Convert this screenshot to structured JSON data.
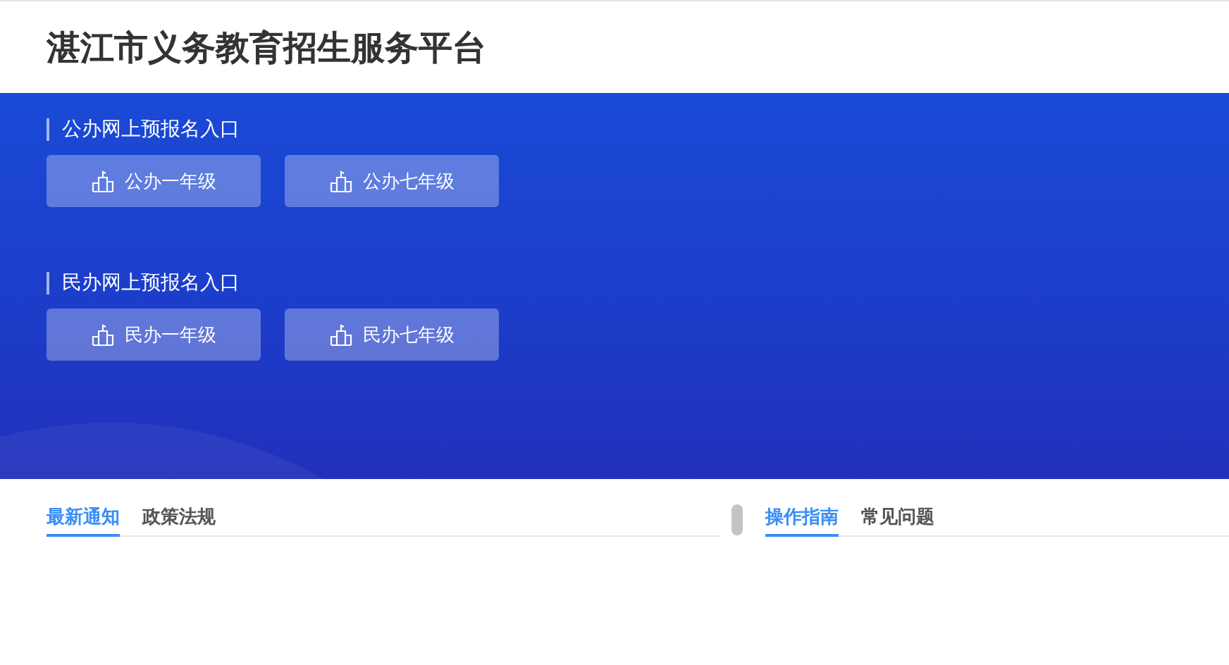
{
  "header": {
    "title": "湛江市义务教育招生服务平台"
  },
  "sections": [
    {
      "title": "公办网上预报名入口",
      "buttons": [
        "公办一年级",
        "公办七年级"
      ]
    },
    {
      "title": "民办网上预报名入口",
      "buttons": [
        "民办一年级",
        "民办七年级"
      ]
    }
  ],
  "panels": [
    {
      "tabs": [
        {
          "label": "最新通知",
          "selected": true
        },
        {
          "label": "政策法规",
          "selected": false
        }
      ]
    },
    {
      "tabs": [
        {
          "label": "操作指南",
          "selected": true
        },
        {
          "label": "常见问题",
          "selected": false
        }
      ]
    }
  ]
}
